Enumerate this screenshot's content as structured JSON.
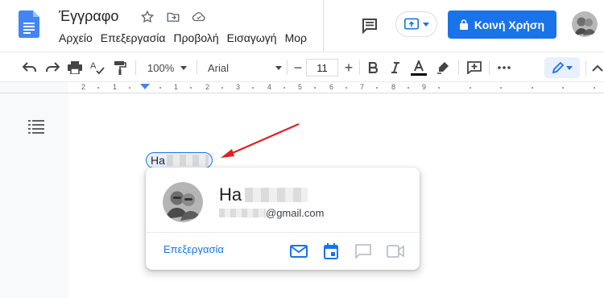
{
  "app": {
    "doc_title": "Έγγραφο",
    "menu": [
      "Αρχείο",
      "Επεξεργασία",
      "Προβολή",
      "Εισαγωγή",
      "Μορ"
    ],
    "share_label": "Κοινή Χρήση"
  },
  "toolbar": {
    "zoom": "100%",
    "font": "Arial",
    "font_size": "11",
    "minus": "−",
    "plus": "+"
  },
  "ruler": {
    "labels": [
      "2",
      "1",
      "1",
      "2",
      "3",
      "4",
      "5",
      "6",
      "7",
      "8",
      "9"
    ]
  },
  "chip": {
    "visible_text": "Ha"
  },
  "card": {
    "name_visible": "Ha",
    "email_suffix": "@gmail.com",
    "edit_label": "Επεξεργασία"
  },
  "colors": {
    "accent": "#1a73e8",
    "arrow": "#e02020",
    "doc_blue": "#4285f4"
  },
  "icons": [
    "star-icon",
    "move-to-folder-icon",
    "cloud-status-icon",
    "comment-history-icon",
    "present-icon",
    "lock-icon",
    "undo-icon",
    "redo-icon",
    "print-icon",
    "spellcheck-icon",
    "paint-format-icon",
    "bold-icon",
    "italic-icon",
    "text-color-icon",
    "highlight-icon",
    "insert-comment-icon",
    "more-icon",
    "editing-mode-icon",
    "collapse-icon",
    "outline-icon",
    "mail-icon",
    "calendar-icon",
    "chat-icon",
    "video-icon"
  ]
}
